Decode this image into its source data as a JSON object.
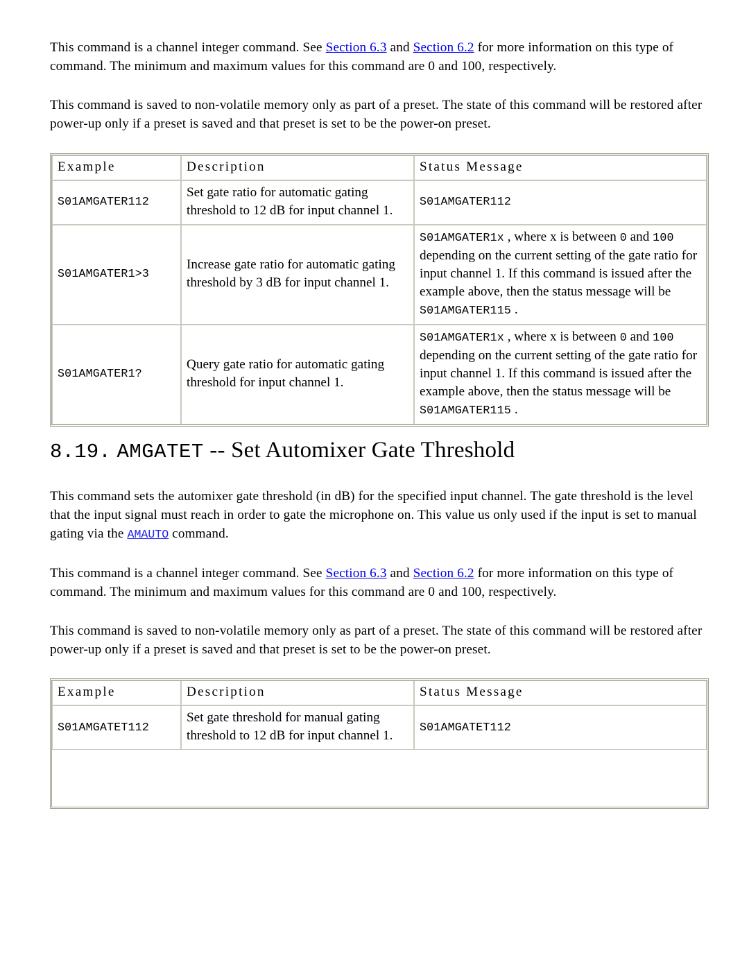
{
  "document": {
    "paragraphs": {
      "channel_integer_1": {
        "t1": "This command is a channel integer command. See ",
        "link1": "Section 6.3",
        "t2": " and ",
        "link2": "Section 6.2",
        "t3": " for more information on this type of command. The minimum and maximum values for this command are 0 and 100, respectively."
      },
      "preset_1": "This command is saved to non-volatile memory only as part of a preset. The state of this command will be restored after power-up only if a preset is saved and that preset is set to be the power-on preset.",
      "intro_amgatet": {
        "t1": "This command sets the automixer gate threshold (in dB) for the specified input channel. The gate threshold is the level that the input signal must reach in order to gate the microphone on. This value us only used if the input is set to manual gating via the ",
        "link1": "AMAUTO",
        "t2": " command."
      },
      "channel_integer_2": {
        "t1": "This command is a channel integer command. See ",
        "link1": "Section 6.3",
        "t2": " and ",
        "link2": "Section 6.2",
        "t3": " for more information on this type of command. The minimum and maximum values for this command are 0 and 100, respectively."
      },
      "preset_2": "This command is saved to non-volatile memory only as part of a preset. The state of this command will be restored after power-up only if a preset is saved and that preset is set to be the power-on preset."
    },
    "heading": {
      "number": "8.19.",
      "command": "AMGATET",
      "dashes": "--",
      "title": "Set Automixer Gate Threshold"
    },
    "table_headers": {
      "example": "Example",
      "description": "Description",
      "status": "Status Message"
    },
    "table_amgater": {
      "rows": [
        {
          "example": "S01AMGATER112",
          "description": "Set gate ratio for automatic gating threshold to 12 dB for input channel 1.",
          "status_lines": [
            {
              "mono": "S01AMGATER112",
              "text": ""
            }
          ]
        },
        {
          "example": "S01AMGATER1>3",
          "description": "Increase gate ratio for automatic gating threshold by 3 dB for input channel 1.",
          "status_lines": [
            {
              "mono": "S01AMGATER1x",
              "text": " , where x is between "
            },
            {
              "mono": "0",
              "text": " and "
            },
            {
              "mono": "100",
              "text": " depending on the current setting of the gate ratio for input channel 1. If this command is issued after the example above, then the status message will be "
            },
            {
              "mono": "S01AMGATER115",
              "text": " ."
            }
          ]
        },
        {
          "example": "S01AMGATER1?",
          "description": "Query gate ratio for automatic gating threshold for input channel 1.",
          "status_lines": [
            {
              "mono": "S01AMGATER1x",
              "text": " , where x is between "
            },
            {
              "mono": "0",
              "text": " and "
            },
            {
              "mono": "100",
              "text": " depending on the current setting of the gate ratio for input channel 1. If this command is issued after the example above, then the status message will be "
            },
            {
              "mono": "S01AMGATER115",
              "text": " ."
            }
          ]
        }
      ]
    },
    "table_amgatet": {
      "rows": [
        {
          "example": "S01AMGATET112",
          "description": "Set gate threshold for manual gating threshold to 12 dB for input channel 1.",
          "status_lines": [
            {
              "mono": "S01AMGATET112",
              "text": ""
            }
          ]
        }
      ]
    }
  }
}
